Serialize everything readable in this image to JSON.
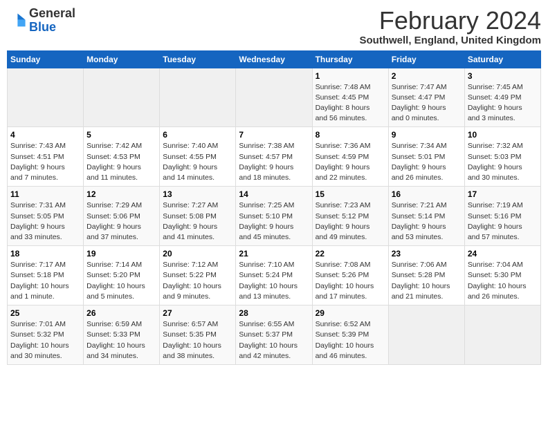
{
  "logo": {
    "general": "General",
    "blue": "Blue"
  },
  "header": {
    "month": "February 2024",
    "location": "Southwell, England, United Kingdom"
  },
  "weekdays": [
    "Sunday",
    "Monday",
    "Tuesday",
    "Wednesday",
    "Thursday",
    "Friday",
    "Saturday"
  ],
  "weeks": [
    [
      {
        "day": "",
        "info": ""
      },
      {
        "day": "",
        "info": ""
      },
      {
        "day": "",
        "info": ""
      },
      {
        "day": "",
        "info": ""
      },
      {
        "day": "1",
        "info": "Sunrise: 7:48 AM\nSunset: 4:45 PM\nDaylight: 8 hours\nand 56 minutes."
      },
      {
        "day": "2",
        "info": "Sunrise: 7:47 AM\nSunset: 4:47 PM\nDaylight: 9 hours\nand 0 minutes."
      },
      {
        "day": "3",
        "info": "Sunrise: 7:45 AM\nSunset: 4:49 PM\nDaylight: 9 hours\nand 3 minutes."
      }
    ],
    [
      {
        "day": "4",
        "info": "Sunrise: 7:43 AM\nSunset: 4:51 PM\nDaylight: 9 hours\nand 7 minutes."
      },
      {
        "day": "5",
        "info": "Sunrise: 7:42 AM\nSunset: 4:53 PM\nDaylight: 9 hours\nand 11 minutes."
      },
      {
        "day": "6",
        "info": "Sunrise: 7:40 AM\nSunset: 4:55 PM\nDaylight: 9 hours\nand 14 minutes."
      },
      {
        "day": "7",
        "info": "Sunrise: 7:38 AM\nSunset: 4:57 PM\nDaylight: 9 hours\nand 18 minutes."
      },
      {
        "day": "8",
        "info": "Sunrise: 7:36 AM\nSunset: 4:59 PM\nDaylight: 9 hours\nand 22 minutes."
      },
      {
        "day": "9",
        "info": "Sunrise: 7:34 AM\nSunset: 5:01 PM\nDaylight: 9 hours\nand 26 minutes."
      },
      {
        "day": "10",
        "info": "Sunrise: 7:32 AM\nSunset: 5:03 PM\nDaylight: 9 hours\nand 30 minutes."
      }
    ],
    [
      {
        "day": "11",
        "info": "Sunrise: 7:31 AM\nSunset: 5:05 PM\nDaylight: 9 hours\nand 33 minutes."
      },
      {
        "day": "12",
        "info": "Sunrise: 7:29 AM\nSunset: 5:06 PM\nDaylight: 9 hours\nand 37 minutes."
      },
      {
        "day": "13",
        "info": "Sunrise: 7:27 AM\nSunset: 5:08 PM\nDaylight: 9 hours\nand 41 minutes."
      },
      {
        "day": "14",
        "info": "Sunrise: 7:25 AM\nSunset: 5:10 PM\nDaylight: 9 hours\nand 45 minutes."
      },
      {
        "day": "15",
        "info": "Sunrise: 7:23 AM\nSunset: 5:12 PM\nDaylight: 9 hours\nand 49 minutes."
      },
      {
        "day": "16",
        "info": "Sunrise: 7:21 AM\nSunset: 5:14 PM\nDaylight: 9 hours\nand 53 minutes."
      },
      {
        "day": "17",
        "info": "Sunrise: 7:19 AM\nSunset: 5:16 PM\nDaylight: 9 hours\nand 57 minutes."
      }
    ],
    [
      {
        "day": "18",
        "info": "Sunrise: 7:17 AM\nSunset: 5:18 PM\nDaylight: 10 hours\nand 1 minute."
      },
      {
        "day": "19",
        "info": "Sunrise: 7:14 AM\nSunset: 5:20 PM\nDaylight: 10 hours\nand 5 minutes."
      },
      {
        "day": "20",
        "info": "Sunrise: 7:12 AM\nSunset: 5:22 PM\nDaylight: 10 hours\nand 9 minutes."
      },
      {
        "day": "21",
        "info": "Sunrise: 7:10 AM\nSunset: 5:24 PM\nDaylight: 10 hours\nand 13 minutes."
      },
      {
        "day": "22",
        "info": "Sunrise: 7:08 AM\nSunset: 5:26 PM\nDaylight: 10 hours\nand 17 minutes."
      },
      {
        "day": "23",
        "info": "Sunrise: 7:06 AM\nSunset: 5:28 PM\nDaylight: 10 hours\nand 21 minutes."
      },
      {
        "day": "24",
        "info": "Sunrise: 7:04 AM\nSunset: 5:30 PM\nDaylight: 10 hours\nand 26 minutes."
      }
    ],
    [
      {
        "day": "25",
        "info": "Sunrise: 7:01 AM\nSunset: 5:32 PM\nDaylight: 10 hours\nand 30 minutes."
      },
      {
        "day": "26",
        "info": "Sunrise: 6:59 AM\nSunset: 5:33 PM\nDaylight: 10 hours\nand 34 minutes."
      },
      {
        "day": "27",
        "info": "Sunrise: 6:57 AM\nSunset: 5:35 PM\nDaylight: 10 hours\nand 38 minutes."
      },
      {
        "day": "28",
        "info": "Sunrise: 6:55 AM\nSunset: 5:37 PM\nDaylight: 10 hours\nand 42 minutes."
      },
      {
        "day": "29",
        "info": "Sunrise: 6:52 AM\nSunset: 5:39 PM\nDaylight: 10 hours\nand 46 minutes."
      },
      {
        "day": "",
        "info": ""
      },
      {
        "day": "",
        "info": ""
      }
    ]
  ]
}
